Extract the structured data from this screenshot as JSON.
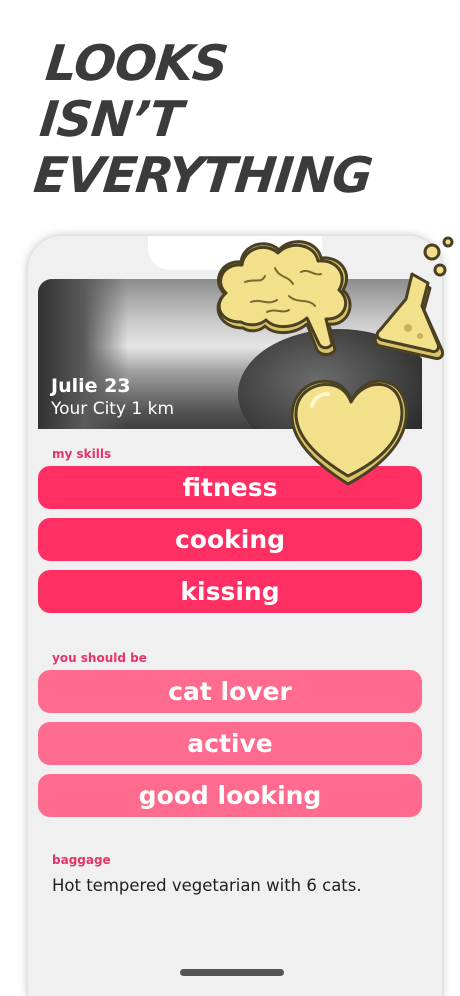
{
  "headline": {
    "line1": "LOOKS",
    "line2": "ISN’T",
    "line3": "EVERYTHING"
  },
  "profile": {
    "name": "Julie 23",
    "location": "Your City 1 km"
  },
  "skills": {
    "label": "my skills",
    "items": [
      "fitness",
      "cooking",
      "kissing"
    ]
  },
  "wants": {
    "label": "you should be",
    "items": [
      "cat lover",
      "active",
      "good looking"
    ]
  },
  "baggage": {
    "label": "baggage",
    "text": "Hot tempered vegetarian with 6 cats."
  },
  "icons": [
    "brain-icon",
    "flask-icon",
    "heart-icon"
  ],
  "colors": {
    "skill_pill": "#ff2e63",
    "want_pill": "#ff6b8e",
    "label_pink": "#e8336a",
    "icon_yellow": "#f3e08a",
    "headline": "#3b3b3b"
  }
}
